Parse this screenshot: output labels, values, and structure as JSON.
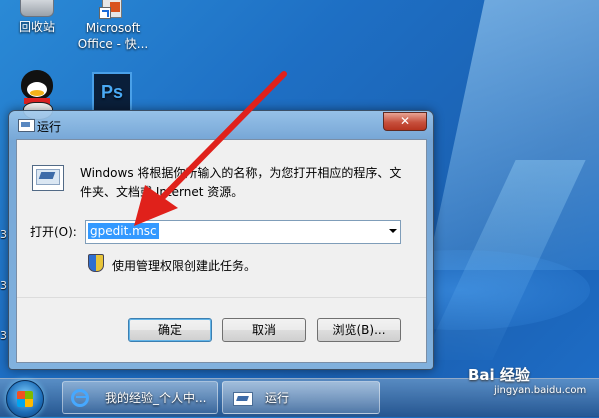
{
  "desktop": {
    "icons": [
      {
        "label": "回收站"
      },
      {
        "label": "Microsoft\nOffice - 快..."
      },
      {
        "label": ""
      },
      {
        "label": ""
      }
    ],
    "edge_digits": [
      "3",
      "3",
      "3"
    ]
  },
  "run_dialog": {
    "title": "运行",
    "close_glyph": "✕",
    "description": "Windows 将根据你所输入的名称，为您打开相应的程序、文件夹、文档或 Internet 资源。",
    "open_label": "打开(O):",
    "open_value": "gpedit.msc",
    "admin_note": "使用管理权限创建此任务。",
    "buttons": {
      "ok": "确定",
      "cancel": "取消",
      "browse": "浏览(B)..."
    }
  },
  "taskbar": {
    "items": [
      {
        "label": "我的经验_个人中..."
      },
      {
        "label": "运行"
      }
    ]
  },
  "watermark": {
    "line1": "Bai 经验",
    "line2": "jingyan.baidu.com"
  },
  "colors": {
    "desktop": "#1e6fc4",
    "annotation_arrow": "#e0211b",
    "selection": "#3399ff"
  }
}
